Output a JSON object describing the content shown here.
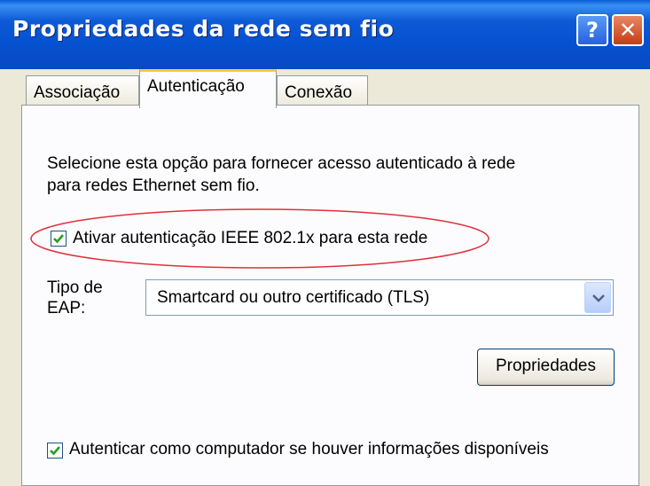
{
  "window": {
    "title": "Propriedades da rede sem fio",
    "help_label": "?",
    "close_label": "✕"
  },
  "tabs": [
    {
      "label": "Associação",
      "selected": false
    },
    {
      "label": "Autenticação",
      "selected": true
    },
    {
      "label": "Conexão",
      "selected": false
    }
  ],
  "panel": {
    "description_line1": "Selecione esta opção para fornecer acesso autenticado à rede",
    "description_line2": "para redes Ethernet sem fio.",
    "enable_8021x": {
      "label": "Ativar autenticação IEEE 802.1x para esta rede",
      "checked": true
    },
    "eap_label_line1": "Tipo de",
    "eap_label_line2": "EAP:",
    "eap_type": {
      "value": "Smartcard ou outro certificado (TLS)"
    },
    "properties_button": "Propriedades",
    "auth_computer": {
      "label": "Autenticar como computador se houver informações disponíveis",
      "checked": true
    }
  },
  "colors": {
    "titlebar": "#0550d0",
    "tab_highlight": "#ffc83c",
    "highlight_ellipse": "#e0303a",
    "check": "#21a121"
  },
  "icons": [
    "help-icon",
    "close-icon",
    "checkmark-icon",
    "chevron-down-icon"
  ]
}
